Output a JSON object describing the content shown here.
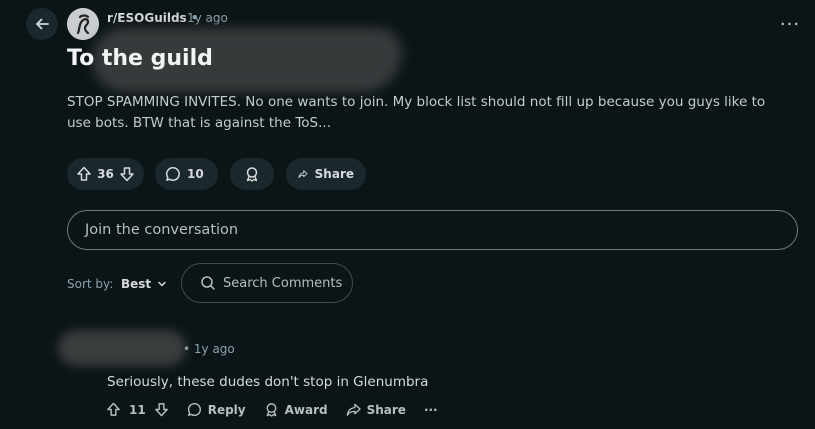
{
  "header": {
    "subreddit": "r/ESOGuilds",
    "separator": "•",
    "time_ago": "1y ago",
    "more_label": "···"
  },
  "post": {
    "title": "To the guild",
    "body": "STOP SPAMMING INVITES. No one wants to join. My block list should not fill up because you guys like to use bots. BTW that is against the ToS...",
    "upvotes": "36",
    "comments": "10",
    "share_label": "Share"
  },
  "composer": {
    "placeholder": "Join the conversation"
  },
  "sort": {
    "label": "Sort by:",
    "value": "Best"
  },
  "search": {
    "placeholder": "Search Comments"
  },
  "comment": {
    "separator": "•",
    "time_ago": "1y ago",
    "body": "Seriously, these dudes don't stop in Glenumbra",
    "score": "11",
    "reply_label": "Reply",
    "award_label": "Award",
    "share_label": "Share",
    "more_label": "···"
  },
  "colors": {
    "background": "#0b1416",
    "pill": "#1a282d",
    "muted": "#8ba2ad"
  }
}
